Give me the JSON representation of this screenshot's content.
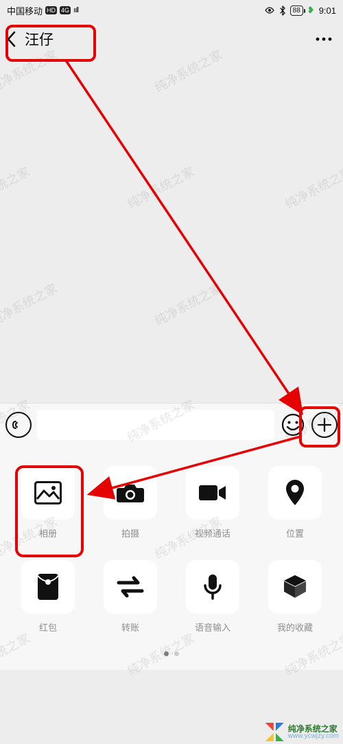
{
  "status": {
    "carrier": "中国移动",
    "hd": "HD",
    "net": "4G",
    "signal": "ııll",
    "battery": "88",
    "time": "9:01"
  },
  "nav": {
    "title": "汪仔"
  },
  "panel": {
    "items": [
      {
        "key": "album",
        "label": "相册"
      },
      {
        "key": "camera",
        "label": "拍摄"
      },
      {
        "key": "video",
        "label": "视频通话"
      },
      {
        "key": "location",
        "label": "位置"
      },
      {
        "key": "redpack",
        "label": "红包"
      },
      {
        "key": "transfer",
        "label": "转账"
      },
      {
        "key": "voice",
        "label": "语音输入"
      },
      {
        "key": "fav",
        "label": "我的收藏"
      }
    ]
  },
  "pager": {
    "active": 0,
    "count": 2
  },
  "annotations": {
    "color": "#e40202"
  },
  "watermark": {
    "text": "纯净系统之家",
    "url": "www.ycwjzy.com",
    "footer1": "纯净系统之家",
    "footer2": "www.ycwjzy.com"
  }
}
